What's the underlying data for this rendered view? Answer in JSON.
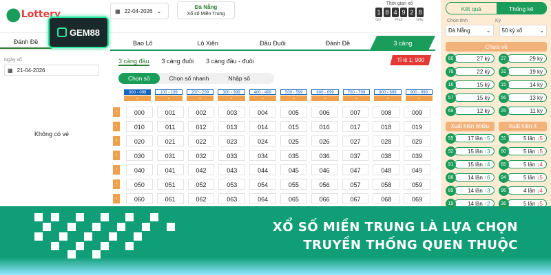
{
  "header": {
    "logo": "Lottery",
    "date": "22-04-2026",
    "province": "Đà Nẵng",
    "region": "Xổ số Miền Trung",
    "timer_label": "Thời gian xổ",
    "timer_digits": [
      "1",
      "8",
      "4",
      "9",
      "2",
      "8"
    ],
    "timer_units": [
      "Giờ",
      "Phút",
      "Giây"
    ]
  },
  "left": {
    "tab1": "Đánh Đề",
    "tab2": "",
    "date_label": "Ngày xổ",
    "date": "21-04-2026",
    "empty": "Không có vé"
  },
  "brand": {
    "name": "GEM88"
  },
  "main": {
    "tabs": [
      "Bao Lô",
      "Lô Xiên",
      "Đầu Đuôi",
      "Đánh Đề",
      "3 càng"
    ],
    "subtabs": [
      "3 càng đầu",
      "3 càng đuôi",
      "3 càng đầu - đuôi"
    ],
    "rate": "Tỉ lệ 1: 900",
    "modes": [
      "Chọn số",
      "Chọn số nhanh",
      "Nhập số"
    ],
    "ranges": [
      "000 - 099",
      "100 - 199",
      "200 - 299",
      "300 - 399",
      "400 - 499",
      "500 - 599",
      "600 - 699",
      "700 - 799",
      "800 - 899",
      "900 - 999"
    ],
    "rows": [
      [
        "000",
        "001",
        "002",
        "003",
        "004",
        "005",
        "006",
        "007",
        "008",
        "009"
      ],
      [
        "010",
        "011",
        "012",
        "013",
        "014",
        "015",
        "016",
        "017",
        "018",
        "019"
      ],
      [
        "020",
        "021",
        "022",
        "023",
        "024",
        "025",
        "026",
        "027",
        "028",
        "029"
      ],
      [
        "030",
        "031",
        "032",
        "033",
        "034",
        "035",
        "036",
        "037",
        "038",
        "039"
      ],
      [
        "040",
        "041",
        "042",
        "043",
        "044",
        "045",
        "046",
        "047",
        "048",
        "049"
      ],
      [
        "050",
        "051",
        "052",
        "053",
        "054",
        "055",
        "056",
        "057",
        "058",
        "059"
      ],
      [
        "060",
        "061",
        "062",
        "063",
        "064",
        "065",
        "066",
        "067",
        "068",
        "069"
      ]
    ]
  },
  "right": {
    "tab1": "Kết quả",
    "tab2": "Thống kê",
    "prov_label": "Chọn tỉnh",
    "ky_label": "Kỳ",
    "province": "Đà Nẵng",
    "ky": "50 kỳ xổ",
    "chuave": "Chưa về",
    "chuave_items": [
      [
        "60",
        "27 kỳ"
      ],
      [
        "27",
        "29 kỳ"
      ],
      [
        "78",
        "22 kỳ"
      ],
      [
        "31",
        "19 kỳ"
      ],
      [
        "16",
        "15 kỳ"
      ],
      [
        "15",
        "14 kỳ"
      ],
      [
        "57",
        "15 kỳ"
      ],
      [
        "56",
        "13 kỳ"
      ],
      [
        "69",
        "12 kỳ"
      ],
      [
        "25",
        "11 kỳ"
      ]
    ],
    "nhieu": "Xuất hiện nhiều",
    "it": "Xuất hiện ít",
    "xh_items": [
      [
        "55",
        "17 lần",
        "↑5",
        "up"
      ],
      [
        "31",
        "5 lần",
        "↓5",
        "down"
      ],
      [
        "92",
        "15 lần",
        "↑3",
        "up"
      ],
      [
        "60",
        "5 lần",
        "↓5",
        "down"
      ],
      [
        "91",
        "15 lần",
        "↑4",
        "up"
      ],
      [
        "65",
        "5 lần",
        "↓4",
        "down"
      ],
      [
        "88",
        "14 lần",
        "↑6",
        "up"
      ],
      [
        "94",
        "5 lần",
        "↓5",
        "down"
      ],
      [
        "89",
        "14 lần",
        "↑3",
        "up"
      ],
      [
        "96",
        "4 lần",
        "↓4",
        "down"
      ],
      [
        "19",
        "14 lần",
        "↑2",
        "up"
      ],
      [
        "36",
        "5 lần",
        "↓5",
        "down"
      ]
    ]
  },
  "banner": {
    "line1": "XỔ SỐ MIỀN TRUNG LÀ LỰA CHỌN",
    "line2": "TRUYỀN THỐNG QUEN THUỘC"
  }
}
